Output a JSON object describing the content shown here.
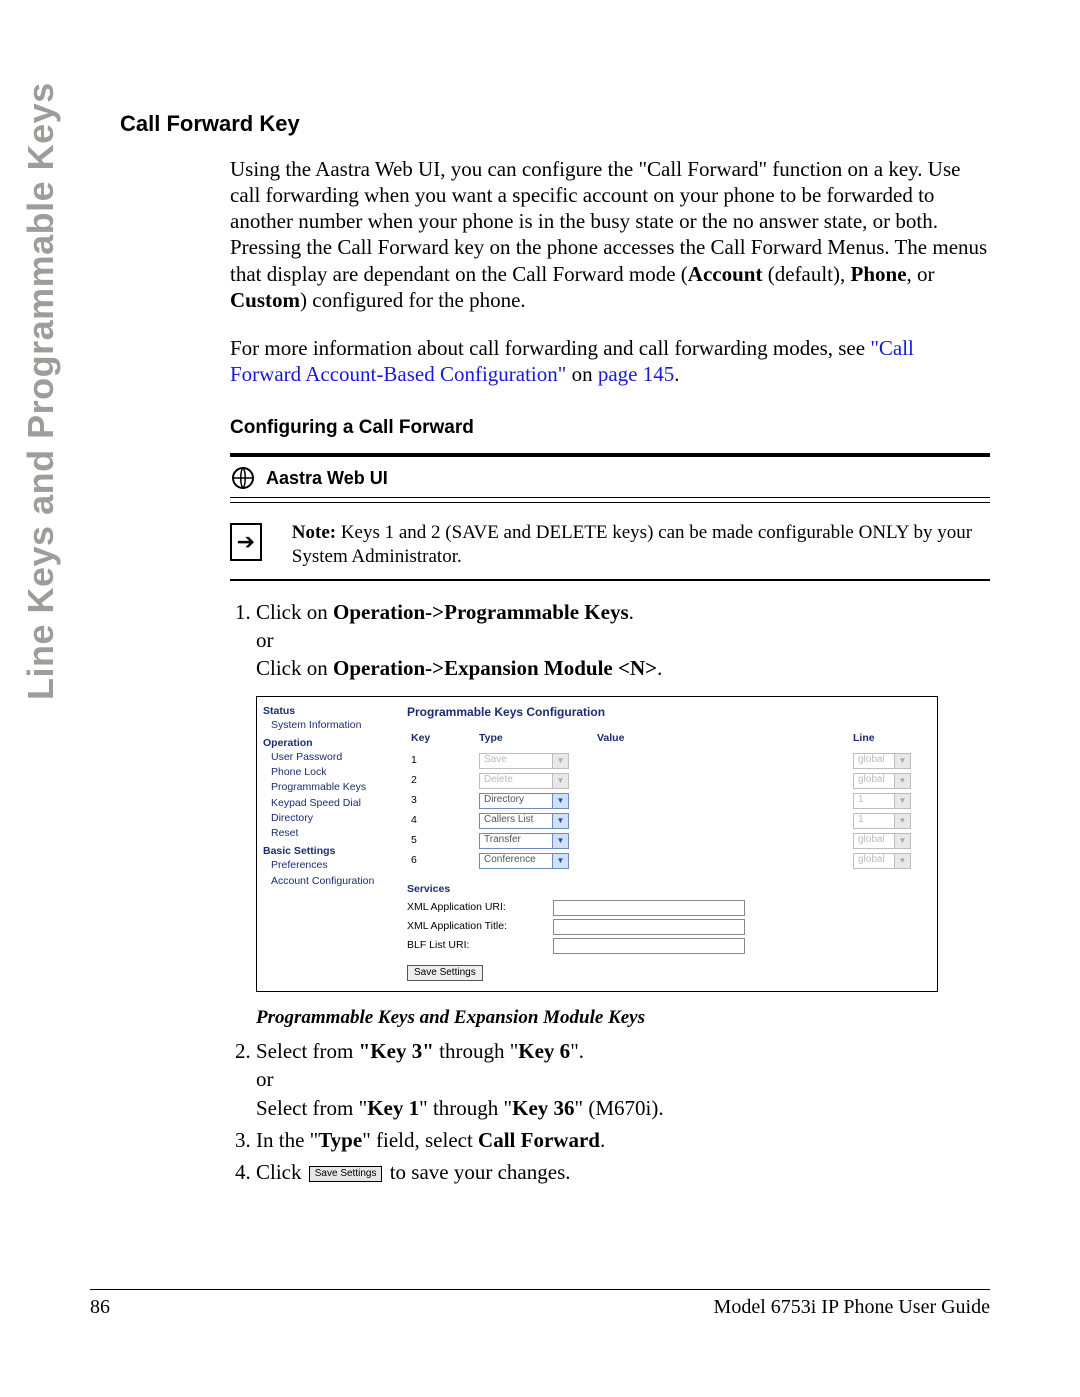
{
  "side_tab": "Line Keys and Programmable Keys",
  "section_title": "Call Forward Key",
  "para1_a": "Using the Aastra Web UI, you can configure the \"Call Forward\" function on a key. Use call forwarding when you want a specific account on your phone to be forwarded to another number when your phone is in the busy state or the no answer state, or both. Pressing the Call Forward key on the phone accesses the Call Forward Menus. The menus that display are dependant on the Call Forward mode (",
  "para1_b": "Account",
  "para1_c": " (default), ",
  "para1_d": "Phone",
  "para1_e": ", or ",
  "para1_f": "Custom",
  "para1_g": ") configured for the phone.",
  "para2_a": "For more information about call forwarding and call forwarding modes, see ",
  "para2_link1": "\"Call Forward Account-Based Configuration\"",
  "para2_b": " on ",
  "para2_link2": "page 145",
  "para2_c": ".",
  "sub_title": "Configuring a Call Forward",
  "webui_label": "Aastra Web UI",
  "note_prefix": "Note:",
  "note_body": " Keys 1 and 2 (SAVE and DELETE keys) can be made configurable ONLY by your System Administrator.",
  "step1_a": "Click on ",
  "step1_b": "Operation->Programmable Keys",
  "step1_c": ".",
  "step1_or": "or",
  "step1_d": "Click on ",
  "step1_e": "Operation->Expansion Module <N>",
  "step1_f": ".",
  "caption": "Programmable Keys and Expansion Module Keys",
  "step2_a": "Select from ",
  "step2_b": "\"Key 3\"",
  "step2_c": " through \"",
  "step2_d": "Key 6",
  "step2_e": "\".",
  "step2_or": "or",
  "step2_f": "Select from \"",
  "step2_g": "Key 1",
  "step2_h": "\" through \"",
  "step2_i": "Key 36",
  "step2_j": "\" (M670i).",
  "step3_a": "In the \"",
  "step3_b": "Type",
  "step3_c": "\" field, select ",
  "step3_d": "Call Forward",
  "step3_e": ".",
  "step4_a": "Click ",
  "step4_btn": "Save Settings",
  "step4_b": " to save your changes.",
  "ui": {
    "sidebar": {
      "status": "Status",
      "sysinfo": "System Information",
      "operation": "Operation",
      "items_op": [
        "User Password",
        "Phone Lock",
        "Programmable Keys",
        "Keypad Speed Dial",
        "Directory",
        "Reset"
      ],
      "basic": "Basic Settings",
      "items_bs": [
        "Preferences",
        "Account Configuration"
      ]
    },
    "main": {
      "title": "Programmable Keys Configuration",
      "headers": {
        "key": "Key",
        "type": "Type",
        "value": "Value",
        "line": "Line"
      },
      "rows": [
        {
          "key": "1",
          "type": "Save",
          "line": "global",
          "type_disabled": true,
          "line_disabled": true,
          "has_value": false
        },
        {
          "key": "2",
          "type": "Delete",
          "line": "global",
          "type_disabled": true,
          "line_disabled": true,
          "has_value": false
        },
        {
          "key": "3",
          "type": "Directory",
          "line": "1",
          "type_disabled": false,
          "line_disabled": true,
          "has_value": false
        },
        {
          "key": "4",
          "type": "Callers List",
          "line": "1",
          "type_disabled": false,
          "line_disabled": true,
          "has_value": false
        },
        {
          "key": "5",
          "type": "Transfer",
          "line": "global",
          "type_disabled": false,
          "line_disabled": true,
          "has_value": false
        },
        {
          "key": "6",
          "type": "Conference",
          "line": "global",
          "type_disabled": false,
          "line_disabled": true,
          "has_value": false
        }
      ],
      "services": "Services",
      "xml_uri": "XML Application URI:",
      "xml_title": "XML Application Title:",
      "blf": "BLF List URI:",
      "save_btn": "Save Settings"
    }
  },
  "footer": {
    "page": "86",
    "doc": "Model 6753i IP Phone User Guide"
  }
}
